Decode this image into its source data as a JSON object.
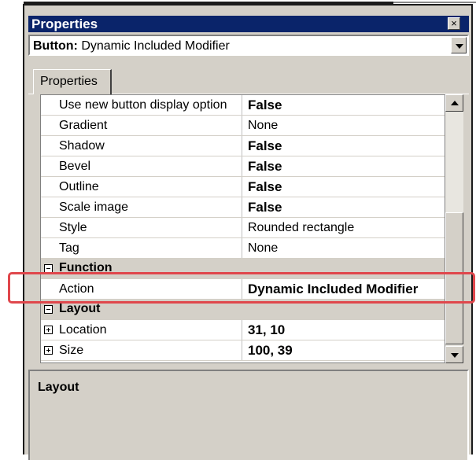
{
  "window": {
    "title": "Properties",
    "close_glyph": "×"
  },
  "object_selector": {
    "type_label": "Button:",
    "object_name": "Dynamic Included Modifier"
  },
  "tabs": [
    {
      "label": "Properties"
    }
  ],
  "grid": {
    "rows": [
      {
        "kind": "prop",
        "name": "Use new button display option",
        "value": "False",
        "bold": true
      },
      {
        "kind": "prop",
        "name": "Gradient",
        "value": "None",
        "bold": false
      },
      {
        "kind": "prop",
        "name": "Shadow",
        "value": "False",
        "bold": true
      },
      {
        "kind": "prop",
        "name": "Bevel",
        "value": "False",
        "bold": true
      },
      {
        "kind": "prop",
        "name": "Outline",
        "value": "False",
        "bold": true
      },
      {
        "kind": "prop",
        "name": "Scale image",
        "value": "False",
        "bold": true
      },
      {
        "kind": "prop",
        "name": "Style",
        "value": "Rounded rectangle",
        "bold": false
      },
      {
        "kind": "prop",
        "name": "Tag",
        "value": "None",
        "bold": false
      },
      {
        "kind": "category",
        "name": "Function",
        "expander": "collapse"
      },
      {
        "kind": "prop",
        "name": "Action",
        "value": "Dynamic Included Modifier",
        "bold": true
      },
      {
        "kind": "category",
        "name": "Layout",
        "expander": "collapse"
      },
      {
        "kind": "expandable",
        "name": "Location",
        "value": "31, 10",
        "bold": true,
        "expander": "expand"
      },
      {
        "kind": "expandable",
        "name": "Size",
        "value": "100, 39",
        "bold": true,
        "expander": "expand"
      }
    ]
  },
  "description": {
    "title": "Layout"
  },
  "annotation": {
    "highlight_color": "#e0474c"
  },
  "colors": {
    "titlebar": "#0a246a",
    "panel": "#d4d0c8"
  }
}
